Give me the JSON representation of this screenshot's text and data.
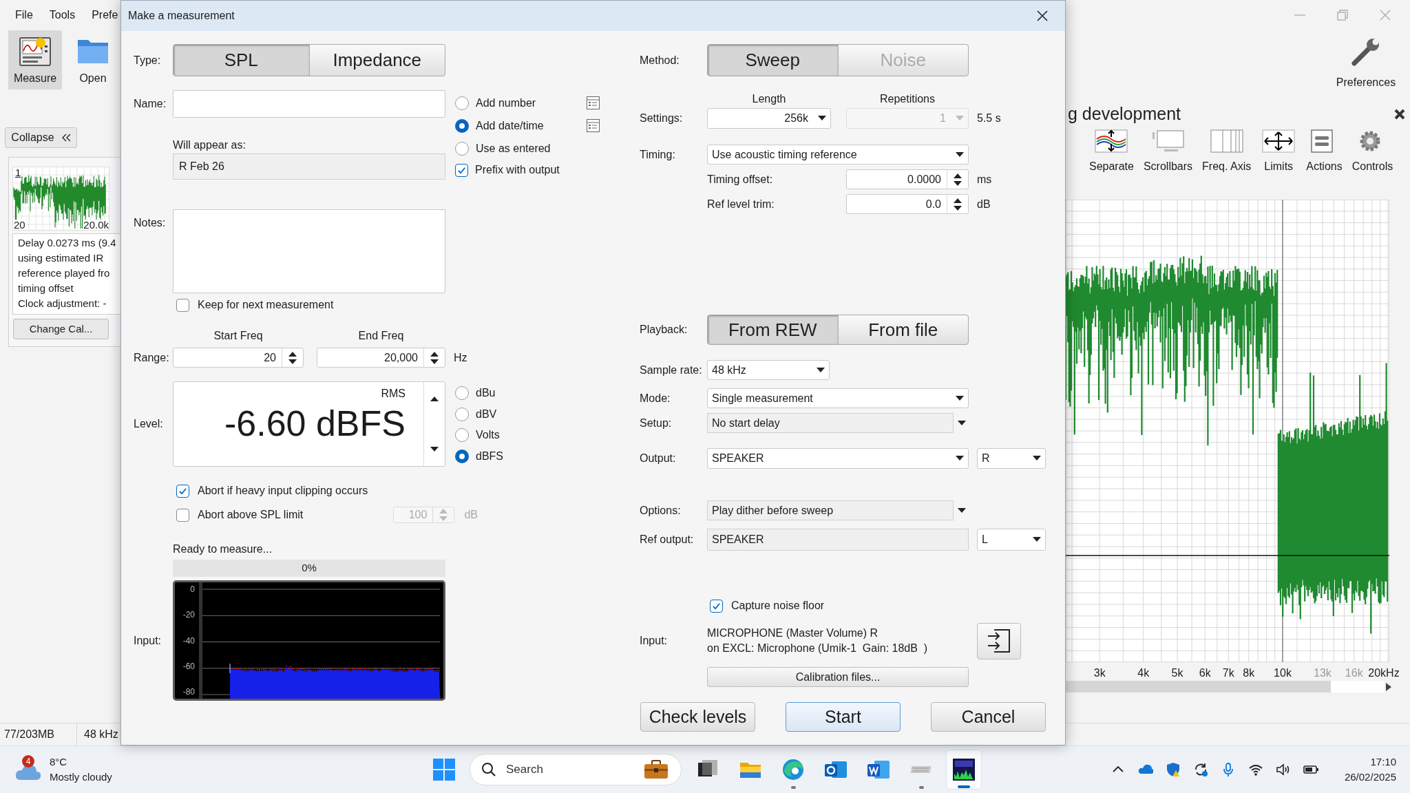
{
  "app": {
    "menu": [
      "File",
      "Tools",
      "Prefe"
    ],
    "toolbar": [
      {
        "label": "Measure",
        "kind": "measure",
        "selected": true
      },
      {
        "label": "Open",
        "kind": "open",
        "selected": false
      }
    ],
    "preferences": "Preferences",
    "side_panel": {
      "collapse": "Collapse",
      "thumb_index": "1",
      "thumb_start": "20",
      "thumb_end": "20.0k",
      "info_lines": [
        "Delay 0.0273 ms (9.4",
        "using estimated IR",
        "reference played fro",
        "timing offset",
        "Clock adjustment: -"
      ],
      "button": "Change Cal..."
    },
    "graph_panel": {
      "title": "g development",
      "tools": [
        {
          "label": "Separate",
          "kind": "separate"
        },
        {
          "label": "Scrollbars",
          "kind": "scrollbars"
        },
        {
          "label": "Freq. Axis",
          "kind": "freq_axis"
        },
        {
          "label": "Limits",
          "kind": "limits"
        },
        {
          "label": "Actions",
          "kind": "actions"
        },
        {
          "label": "Controls",
          "kind": "controls"
        }
      ],
      "x_labels": [
        {
          "label": "3k",
          "muted": false
        },
        {
          "label": "4k",
          "muted": false
        },
        {
          "label": "5k",
          "muted": false
        },
        {
          "label": "6k",
          "muted": false
        },
        {
          "label": "7k",
          "muted": false
        },
        {
          "label": "8k",
          "muted": false
        },
        {
          "label": "10k",
          "muted": false
        },
        {
          "label": "13k",
          "muted": true
        },
        {
          "label": "16k",
          "muted": true
        },
        {
          "label": "20kHz",
          "muted": false
        }
      ]
    },
    "status_bar": [
      "77/203MB",
      "48 kHz"
    ]
  },
  "dialog": {
    "title": "Make a measurement",
    "type": {
      "label": "Type:",
      "options": [
        {
          "label": "SPL",
          "selected": true
        },
        {
          "label": "Impedance",
          "selected": false
        }
      ]
    },
    "name": {
      "label": "Name:"
    },
    "name_mode": [
      {
        "label": "Add number",
        "selected": false,
        "has_settings": true
      },
      {
        "label": "Add date/time",
        "selected": true,
        "has_settings": true
      },
      {
        "label": "Use as entered",
        "selected": false,
        "has_settings": false
      }
    ],
    "prefix_with_output": {
      "label": "Prefix with output",
      "checked": true
    },
    "preview": {
      "label": "Will appear as:",
      "value": "R Feb 26"
    },
    "notes": {
      "label": "Notes:"
    },
    "keep_notes": {
      "label": "Keep for next measurement",
      "checked": false
    },
    "range": {
      "label": "Range:",
      "start_header": "Start Freq",
      "start": "20",
      "end_header": "End Freq",
      "end": "20,000",
      "unit": "Hz"
    },
    "level": {
      "label": "Level:",
      "mode": "RMS",
      "value": "-6.60 dBFS",
      "units": [
        {
          "label": "dBu",
          "selected": false
        },
        {
          "label": "dBV",
          "selected": false
        },
        {
          "label": "Volts",
          "selected": false
        },
        {
          "label": "dBFS",
          "selected": true
        }
      ]
    },
    "abort_clipping": {
      "label": "Abort if heavy input clipping occurs",
      "checked": true
    },
    "abort_spl": {
      "label": "Abort above SPL limit",
      "checked": false,
      "value": "100",
      "unit": "dB"
    },
    "status": "Ready to measure...",
    "progress": {
      "level": 0,
      "label": "0%"
    },
    "input_meter": {
      "label": "Input:",
      "ticks": [
        "0",
        "-20",
        "-40",
        "-60",
        "-80"
      ]
    },
    "method": {
      "label": "Method:",
      "options": [
        {
          "label": "Sweep",
          "selected": true,
          "disabled": false
        },
        {
          "label": "Noise",
          "selected": false,
          "disabled": true
        }
      ]
    },
    "settings": {
      "label": "Settings:",
      "length_header": "Length",
      "length": "256k",
      "repetitions_header": "Repetitions",
      "repetitions": "1",
      "repetitions_disabled": true,
      "duration": "5.5 s"
    },
    "timing": {
      "label": "Timing:",
      "value": "Use acoustic timing reference"
    },
    "timing_offset": {
      "label": "Timing offset:",
      "value": "0.0000",
      "unit": "ms"
    },
    "ref_level_trim": {
      "label": "Ref level trim:",
      "value": "0.0",
      "unit": "dB"
    },
    "playback": {
      "label": "Playback:",
      "options": [
        {
          "label": "From REW",
          "selected": true
        },
        {
          "label": "From file",
          "selected": false
        }
      ]
    },
    "sample_rate": {
      "label": "Sample rate:",
      "value": "48 kHz"
    },
    "mode": {
      "label": "Mode:",
      "value": "Single measurement"
    },
    "setup": {
      "label": "Setup:",
      "value": "No start delay"
    },
    "output": {
      "label": "Output:",
      "value": "SPEAKER",
      "channel": "R"
    },
    "options": {
      "label": "Options:",
      "value": "Play dither before sweep"
    },
    "ref_output": {
      "label": "Ref output:",
      "value": "SPEAKER",
      "channel": "L"
    },
    "capture_noise_floor": {
      "label": "Capture noise floor",
      "checked": true
    },
    "input": {
      "label": "Input:",
      "lines": [
        "MICROPHONE (Master Volume) R",
        "on EXCL: Microphone (Umik-1  Gain: 18dB  )"
      ]
    },
    "calibration_button": "Calibration files...",
    "buttons": [
      {
        "label": "Check levels",
        "kind": "default"
      },
      {
        "label": "Start",
        "kind": "primary"
      },
      {
        "label": "Cancel",
        "kind": "default"
      }
    ]
  },
  "taskbar": {
    "weather": {
      "badge": "4",
      "temperature": "8°C",
      "condition": "Mostly cloudy"
    },
    "search": {
      "placeholder": "Search"
    },
    "apps": [
      {
        "kind": "task_view",
        "running": false,
        "selected": false
      },
      {
        "kind": "files",
        "running": false,
        "selected": false
      },
      {
        "kind": "browser",
        "running": true,
        "selected": false
      },
      {
        "kind": "mail",
        "running": false,
        "selected": false
      },
      {
        "kind": "document",
        "running": false,
        "selected": false
      },
      {
        "kind": "dsp",
        "running": true,
        "selected": false
      },
      {
        "kind": "analyzer",
        "running": true,
        "selected": true
      }
    ],
    "time": "17:10",
    "date": "26/02/2025"
  }
}
